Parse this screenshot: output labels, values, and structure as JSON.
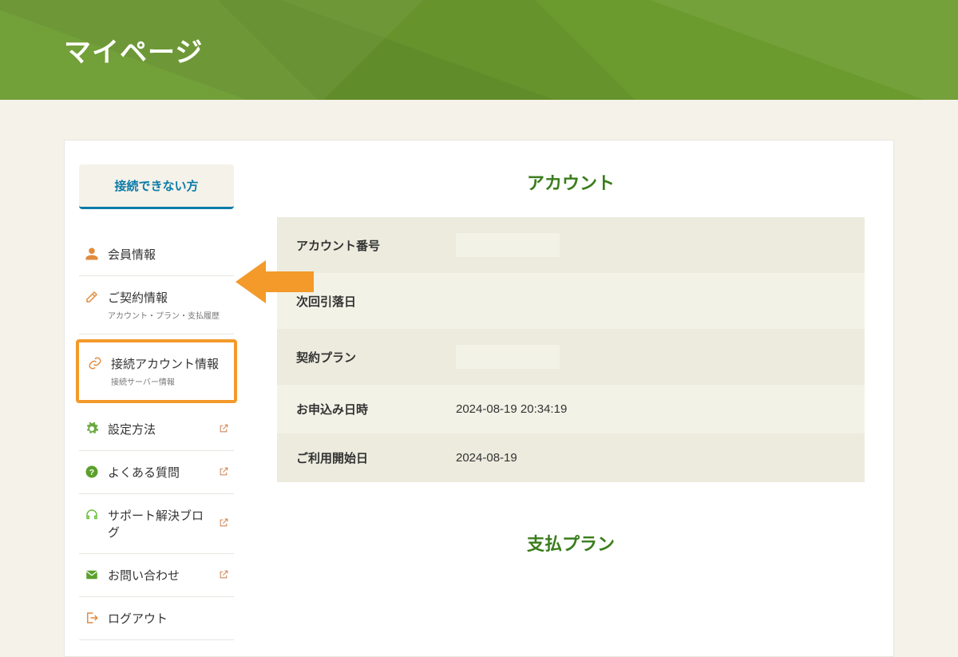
{
  "header": {
    "title": "マイページ"
  },
  "sidebar": {
    "cta": "接続できない方",
    "items": [
      {
        "icon": "person-icon",
        "label": "会員情報",
        "sub": "",
        "external": false,
        "highlighted": false
      },
      {
        "icon": "edit-icon",
        "label": "ご契約情報",
        "sub": "アカウント・プラン・支払履歴",
        "external": false,
        "highlighted": false
      },
      {
        "icon": "link-icon",
        "label": "接続アカウント情報",
        "sub": "接続サーバー情報",
        "external": false,
        "highlighted": true
      },
      {
        "icon": "gear-icon",
        "label": "設定方法",
        "sub": "",
        "external": true,
        "highlighted": false
      },
      {
        "icon": "help-icon",
        "label": "よくある質問",
        "sub": "",
        "external": true,
        "highlighted": false
      },
      {
        "icon": "headset-icon",
        "label": "サポート解決ブログ",
        "sub": "",
        "external": true,
        "highlighted": false
      },
      {
        "icon": "mail-icon",
        "label": "お問い合わせ",
        "sub": "",
        "external": true,
        "highlighted": false
      },
      {
        "icon": "logout-icon",
        "label": "ログアウト",
        "sub": "",
        "external": false,
        "highlighted": false
      }
    ]
  },
  "main": {
    "account_section_title": "アカウント",
    "payment_section_title": "支払プラン",
    "rows": [
      {
        "label": "アカウント番号",
        "value": ""
      },
      {
        "label": "次回引落日",
        "value": ""
      },
      {
        "label": "契約プラン",
        "value": ""
      },
      {
        "label": "お申込み日時",
        "value": "2024-08-19 20:34:19"
      },
      {
        "label": "ご利用開始日",
        "value": "2024-08-19"
      }
    ]
  }
}
